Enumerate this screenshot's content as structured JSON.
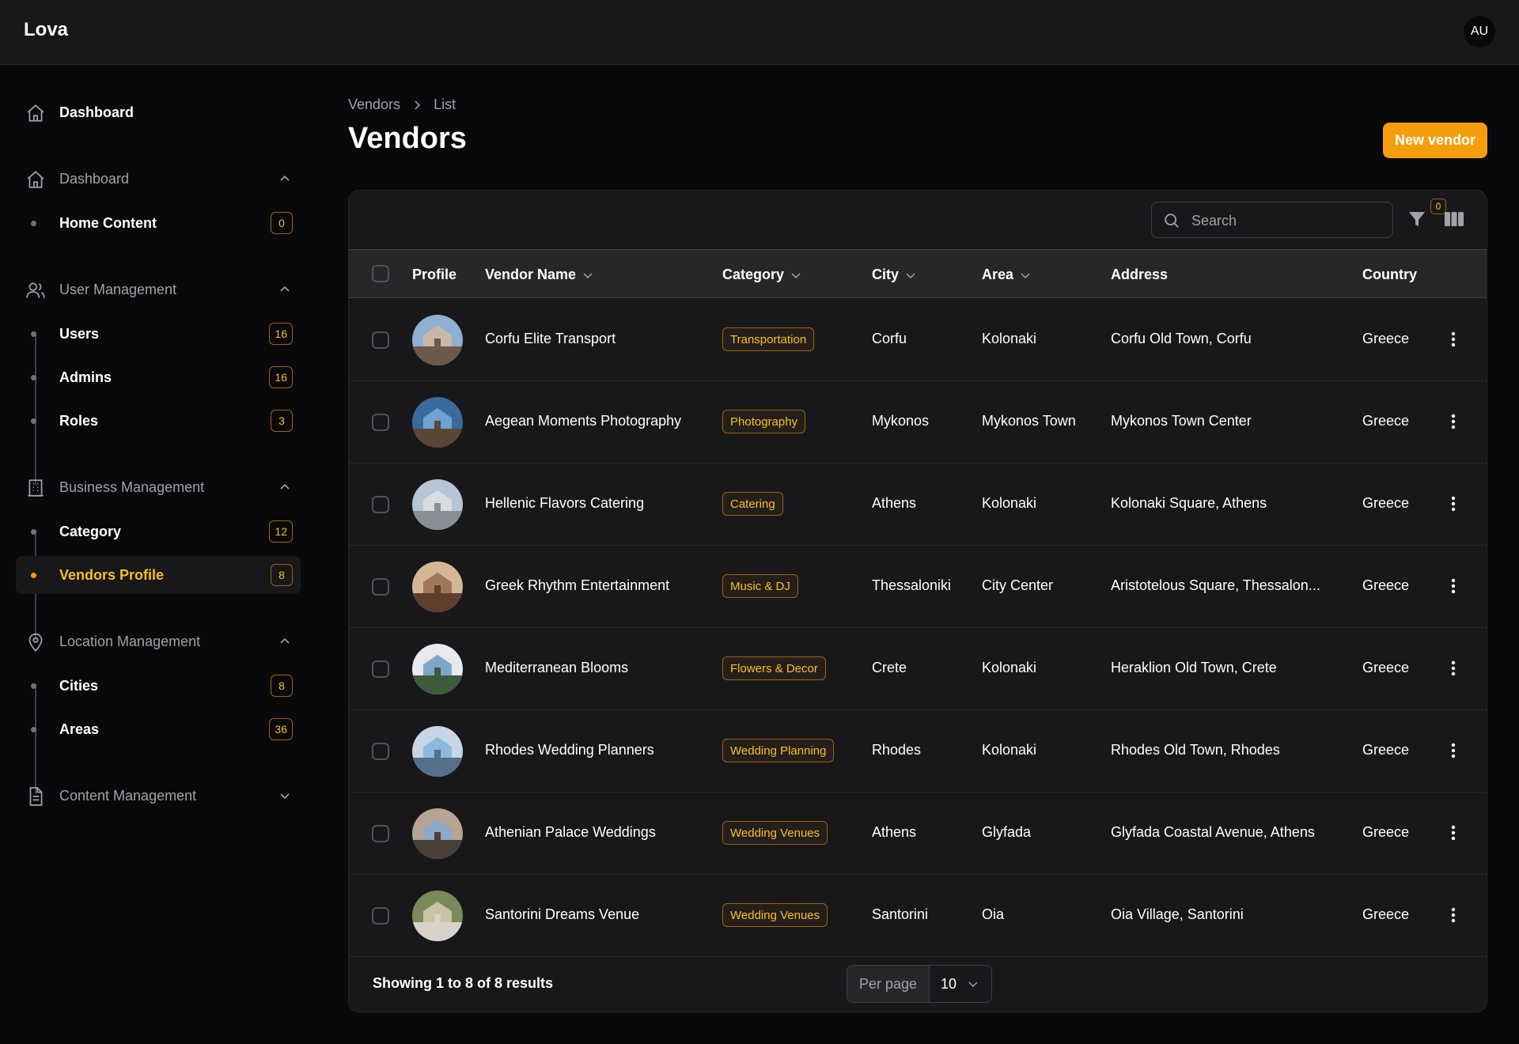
{
  "app": {
    "brand": "Lova",
    "user_initials": "AU"
  },
  "sidebar": {
    "dashboard": "Dashboard",
    "groups": {
      "dashboard": {
        "label": "Dashboard",
        "items": [
          {
            "label": "Home Content",
            "count": "0"
          }
        ]
      },
      "user_management": {
        "label": "User Management",
        "items": [
          {
            "label": "Users",
            "count": "16"
          },
          {
            "label": "Admins",
            "count": "16"
          },
          {
            "label": "Roles",
            "count": "3"
          }
        ]
      },
      "business_management": {
        "label": "Business Management",
        "items": [
          {
            "label": "Category",
            "count": "12"
          },
          {
            "label": "Vendors Profile",
            "count": "8",
            "active": true
          }
        ]
      },
      "location_management": {
        "label": "Location Management",
        "items": [
          {
            "label": "Cities",
            "count": "8"
          },
          {
            "label": "Areas",
            "count": "36"
          }
        ]
      },
      "content_management": {
        "label": "Content Management"
      }
    }
  },
  "breadcrumb": {
    "parent": "Vendors",
    "current": "List"
  },
  "page": {
    "title": "Vendors",
    "new_button": "New vendor"
  },
  "toolbar": {
    "search_placeholder": "Search",
    "filter_count": "0"
  },
  "table": {
    "columns": {
      "profile": "Profile",
      "vendor_name": "Vendor Name",
      "category": "Category",
      "city": "City",
      "area": "Area",
      "address": "Address",
      "country": "Country"
    },
    "rows": [
      {
        "name": "Corfu Elite Transport",
        "category": "Transportation",
        "city": "Corfu",
        "area": "Kolonaki",
        "address": "Corfu Old Town, Corfu",
        "country": "Greece"
      },
      {
        "name": "Aegean Moments Photography",
        "category": "Photography",
        "city": "Mykonos",
        "area": "Mykonos Town",
        "address": "Mykonos Town Center",
        "country": "Greece"
      },
      {
        "name": "Hellenic Flavors Catering",
        "category": "Catering",
        "city": "Athens",
        "area": "Kolonaki",
        "address": "Kolonaki Square, Athens",
        "country": "Greece"
      },
      {
        "name": "Greek Rhythm Entertainment",
        "category": "Music & DJ",
        "city": "Thessaloniki",
        "area": "City Center",
        "address": "Aristotelous Square, Thessalon...",
        "country": "Greece"
      },
      {
        "name": "Mediterranean Blooms",
        "category": "Flowers & Decor",
        "city": "Crete",
        "area": "Kolonaki",
        "address": "Heraklion Old Town, Crete",
        "country": "Greece"
      },
      {
        "name": "Rhodes Wedding Planners",
        "category": "Wedding Planning",
        "city": "Rhodes",
        "area": "Kolonaki",
        "address": "Rhodes Old Town, Rhodes",
        "country": "Greece"
      },
      {
        "name": "Athenian Palace Weddings",
        "category": "Wedding Venues",
        "city": "Athens",
        "area": "Glyfada",
        "address": "Glyfada Coastal Avenue, Athens",
        "country": "Greece"
      },
      {
        "name": "Santorini Dreams Venue",
        "category": "Wedding Venues",
        "city": "Santorini",
        "area": "Oia",
        "address": "Oia Village, Santorini",
        "country": "Greece"
      }
    ]
  },
  "footer": {
    "summary": "Showing 1 to 8 of 8 results",
    "per_page_label": "Per page",
    "per_page_value": "10"
  },
  "colors": {
    "accent": "#f59e0b",
    "background": "#09090b",
    "surface": "#18181b"
  }
}
